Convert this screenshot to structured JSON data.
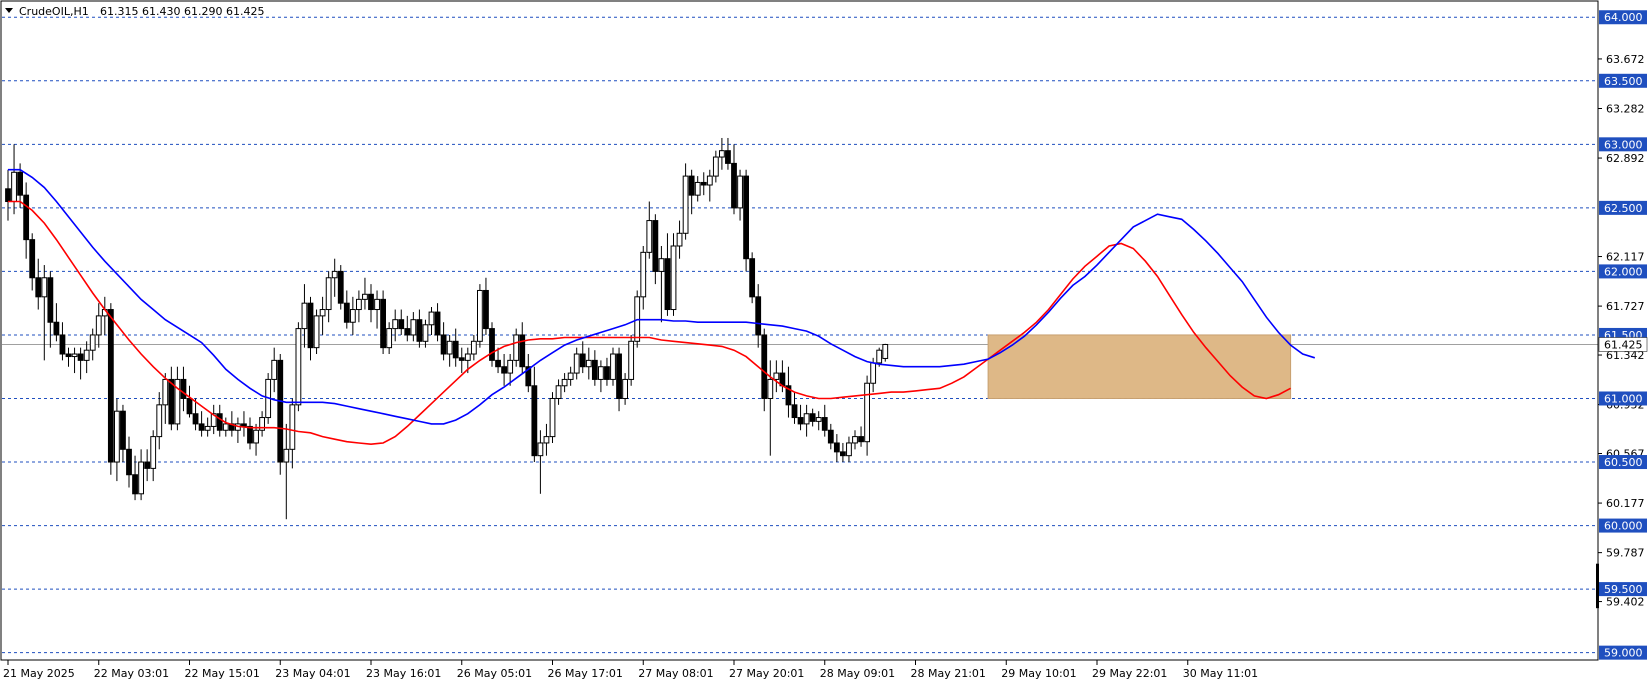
{
  "header": {
    "symbol": "CrudeOIL,H1",
    "ohlc": "61.315 61.430 61.290 61.425",
    "menu_icon": "triangle-down-icon"
  },
  "colors": {
    "bull_body": "#ffffff",
    "bear_body": "#000000",
    "ema_fast": "#0000ff",
    "ema_slow": "#ff0000",
    "grid_line": "#1f4fbf",
    "badge_fill": "#1f4fbf",
    "zone_fill": "#deb887",
    "zone_stroke": "#c8a070"
  },
  "chart_data": {
    "type": "candlestick",
    "symbol": "CrudeOIL",
    "timeframe": "H1",
    "last_price": 61.425,
    "ylim": [
      58.95,
      64.12
    ],
    "price_axis_ticks": [
      "64.000",
      "63.672",
      "63.500",
      "63.282",
      "63.000",
      "62.892",
      "62.500",
      "62.117",
      "62.000",
      "61.727",
      "61.500",
      "61.425",
      "61.342",
      "61.000",
      "60.952",
      "60.567",
      "60.500",
      "60.177",
      "60.000",
      "59.787",
      "59.500",
      "59.402",
      "59.000"
    ],
    "level_lines": [
      64.0,
      63.5,
      63.0,
      62.5,
      62.0,
      61.5,
      61.0,
      60.5,
      60.0,
      59.5,
      59.0
    ],
    "level_labels": [
      "64.000",
      "63.500",
      "63.000",
      "62.500",
      "62.000",
      "61.500",
      "61.000",
      "60.500",
      "60.000",
      "59.500",
      "59.000"
    ],
    "unmarked_ticks": [
      63.672,
      63.282,
      62.892,
      62.117,
      61.727,
      61.342,
      60.952,
      60.567,
      60.177,
      59.787,
      59.402
    ],
    "unmarked_labels": [
      "63.672",
      "63.282",
      "62.892",
      "62.117",
      "61.727",
      "61.342",
      "60.952",
      "60.567",
      "60.177",
      "59.787",
      "59.402"
    ],
    "time_labels": [
      "21 May 2025",
      "22 May 03:01",
      "22 May 15:01",
      "23 May 04:01",
      "23 May 16:01",
      "26 May 05:01",
      "26 May 17:01",
      "27 May 08:01",
      "27 May 20:01",
      "28 May 09:01",
      "28 May 21:01",
      "29 May 10:01",
      "29 May 22:01",
      "30 May 11:01"
    ],
    "time_label_bar_index": [
      0,
      15,
      30,
      45,
      60,
      75,
      90,
      105,
      120,
      135,
      150,
      165,
      180,
      195
    ],
    "candles": [
      [
        62.65,
        62.8,
        62.4,
        62.55
      ],
      [
        62.55,
        63.0,
        62.45,
        62.78
      ],
      [
        62.78,
        62.85,
        62.5,
        62.6
      ],
      [
        62.6,
        62.7,
        62.1,
        62.25
      ],
      [
        62.25,
        62.3,
        61.85,
        61.95
      ],
      [
        61.95,
        62.1,
        61.7,
        61.8
      ],
      [
        61.8,
        62.05,
        61.3,
        61.95
      ],
      [
        61.95,
        62.0,
        61.4,
        61.6
      ],
      [
        61.6,
        61.75,
        61.45,
        61.5
      ],
      [
        61.5,
        61.6,
        61.3,
        61.35
      ],
      [
        61.35,
        61.4,
        61.25,
        61.33
      ],
      [
        61.33,
        61.4,
        61.2,
        61.35
      ],
      [
        61.35,
        61.4,
        61.15,
        61.3
      ],
      [
        61.3,
        61.45,
        61.2,
        61.38
      ],
      [
        61.38,
        61.55,
        61.3,
        61.5
      ],
      [
        61.5,
        61.75,
        61.4,
        61.65
      ],
      [
        61.65,
        61.8,
        61.5,
        61.7
      ],
      [
        61.7,
        61.75,
        60.4,
        60.5
      ],
      [
        60.5,
        61.0,
        60.35,
        60.9
      ],
      [
        60.9,
        60.95,
        60.5,
        60.6
      ],
      [
        60.6,
        60.7,
        60.3,
        60.4
      ],
      [
        60.4,
        60.55,
        60.2,
        60.25
      ],
      [
        60.25,
        60.6,
        60.2,
        60.5
      ],
      [
        60.5,
        60.6,
        60.35,
        60.45
      ],
      [
        60.45,
        60.75,
        60.35,
        60.7
      ],
      [
        60.7,
        61.05,
        60.6,
        60.95
      ],
      [
        60.95,
        61.2,
        60.8,
        61.15
      ],
      [
        61.15,
        61.25,
        60.75,
        60.8
      ],
      [
        60.8,
        61.25,
        60.75,
        61.15
      ],
      [
        61.15,
        61.25,
        60.9,
        61.0
      ],
      [
        61.0,
        61.1,
        60.85,
        60.88
      ],
      [
        60.88,
        61.0,
        60.75,
        60.8
      ],
      [
        60.8,
        60.9,
        60.7,
        60.75
      ],
      [
        60.75,
        60.85,
        60.7,
        60.78
      ],
      [
        60.78,
        60.95,
        60.72,
        60.88
      ],
      [
        60.88,
        60.95,
        60.7,
        60.75
      ],
      [
        60.75,
        60.85,
        60.7,
        60.8
      ],
      [
        60.8,
        60.9,
        60.7,
        60.75
      ],
      [
        60.75,
        60.85,
        60.65,
        60.8
      ],
      [
        60.8,
        60.9,
        60.7,
        60.78
      ],
      [
        60.78,
        60.85,
        60.6,
        60.65
      ],
      [
        60.65,
        60.8,
        60.55,
        60.75
      ],
      [
        60.75,
        60.9,
        60.7,
        60.85
      ],
      [
        60.85,
        61.2,
        60.8,
        61.15
      ],
      [
        61.15,
        61.4,
        61.05,
        61.3
      ],
      [
        61.3,
        61.35,
        60.4,
        60.5
      ],
      [
        60.5,
        60.8,
        60.05,
        60.6
      ],
      [
        60.6,
        61.0,
        60.45,
        60.95
      ],
      [
        60.95,
        61.6,
        60.9,
        61.55
      ],
      [
        61.55,
        61.9,
        61.4,
        61.75
      ],
      [
        61.75,
        61.8,
        61.3,
        61.4
      ],
      [
        61.4,
        61.7,
        61.35,
        61.65
      ],
      [
        61.65,
        61.8,
        61.5,
        61.7
      ],
      [
        61.7,
        62.0,
        61.6,
        61.95
      ],
      [
        61.95,
        62.1,
        61.8,
        62.0
      ],
      [
        62.0,
        62.05,
        61.7,
        61.75
      ],
      [
        61.75,
        61.85,
        61.55,
        61.6
      ],
      [
        61.6,
        61.8,
        61.5,
        61.7
      ],
      [
        61.7,
        61.85,
        61.6,
        61.78
      ],
      [
        61.78,
        61.95,
        61.7,
        61.82
      ],
      [
        61.82,
        61.9,
        61.6,
        61.7
      ],
      [
        61.7,
        61.85,
        61.55,
        61.78
      ],
      [
        61.78,
        61.85,
        61.35,
        61.4
      ],
      [
        61.4,
        61.6,
        61.35,
        61.55
      ],
      [
        61.55,
        61.7,
        61.45,
        61.62
      ],
      [
        61.62,
        61.7,
        61.5,
        61.55
      ],
      [
        61.55,
        61.65,
        61.45,
        61.5
      ],
      [
        61.5,
        61.68,
        61.45,
        61.62
      ],
      [
        61.62,
        61.7,
        61.4,
        61.45
      ],
      [
        61.45,
        61.62,
        61.4,
        61.58
      ],
      [
        61.58,
        61.72,
        61.5,
        61.68
      ],
      [
        61.68,
        61.75,
        61.45,
        61.5
      ],
      [
        61.5,
        61.6,
        61.3,
        61.35
      ],
      [
        61.35,
        61.5,
        61.25,
        61.45
      ],
      [
        61.45,
        61.55,
        61.25,
        61.32
      ],
      [
        61.32,
        61.4,
        61.2,
        61.3
      ],
      [
        61.3,
        61.4,
        61.2,
        61.35
      ],
      [
        61.35,
        61.5,
        61.3,
        61.45
      ],
      [
        61.45,
        61.9,
        61.4,
        61.85
      ],
      [
        61.85,
        61.95,
        61.5,
        61.55
      ],
      [
        61.55,
        61.6,
        61.25,
        61.3
      ],
      [
        61.3,
        61.4,
        61.2,
        61.25
      ],
      [
        61.25,
        61.35,
        61.1,
        61.2
      ],
      [
        61.2,
        61.35,
        61.1,
        61.3
      ],
      [
        61.3,
        61.55,
        61.25,
        61.5
      ],
      [
        61.5,
        61.6,
        61.2,
        61.25
      ],
      [
        61.25,
        61.35,
        61.05,
        61.1
      ],
      [
        61.1,
        61.25,
        60.5,
        60.55
      ],
      [
        60.55,
        60.75,
        60.25,
        60.65
      ],
      [
        60.65,
        60.8,
        60.55,
        60.7
      ],
      [
        60.7,
        61.05,
        60.65,
        61.0
      ],
      [
        61.0,
        61.15,
        60.95,
        61.1
      ],
      [
        61.1,
        61.2,
        61.05,
        61.15
      ],
      [
        61.15,
        61.25,
        61.1,
        61.2
      ],
      [
        61.2,
        61.4,
        61.15,
        61.35
      ],
      [
        61.35,
        61.45,
        61.2,
        61.25
      ],
      [
        61.25,
        61.4,
        61.15,
        61.3
      ],
      [
        61.3,
        61.38,
        61.1,
        61.15
      ],
      [
        61.15,
        61.3,
        61.05,
        61.25
      ],
      [
        61.25,
        61.32,
        61.1,
        61.15
      ],
      [
        61.15,
        61.4,
        61.1,
        61.35
      ],
      [
        61.35,
        61.4,
        60.9,
        61.0
      ],
      [
        61.0,
        61.2,
        60.95,
        61.15
      ],
      [
        61.15,
        61.5,
        61.1,
        61.45
      ],
      [
        61.45,
        61.85,
        61.4,
        61.8
      ],
      [
        61.8,
        62.2,
        61.7,
        62.15
      ],
      [
        62.15,
        62.55,
        62.1,
        62.4
      ],
      [
        62.4,
        62.45,
        61.9,
        62.0
      ],
      [
        62.0,
        62.2,
        61.6,
        62.1
      ],
      [
        62.1,
        62.3,
        61.65,
        61.7
      ],
      [
        61.7,
        62.3,
        61.65,
        62.2
      ],
      [
        62.2,
        62.4,
        62.1,
        62.3
      ],
      [
        62.3,
        62.85,
        62.25,
        62.75
      ],
      [
        62.75,
        62.8,
        62.45,
        62.6
      ],
      [
        62.6,
        62.75,
        62.55,
        62.7
      ],
      [
        62.7,
        62.78,
        62.6,
        62.68
      ],
      [
        62.68,
        62.8,
        62.55,
        62.75
      ],
      [
        62.75,
        62.95,
        62.7,
        62.9
      ],
      [
        62.9,
        63.05,
        62.8,
        62.95
      ],
      [
        62.95,
        63.05,
        62.8,
        62.85
      ],
      [
        62.85,
        63.0,
        62.45,
        62.5
      ],
      [
        62.5,
        62.8,
        62.4,
        62.75
      ],
      [
        62.75,
        62.8,
        62.0,
        62.1
      ],
      [
        62.1,
        62.15,
        61.75,
        61.8
      ],
      [
        61.8,
        61.9,
        61.4,
        61.5
      ],
      [
        61.5,
        61.55,
        60.9,
        61.0
      ],
      [
        61.0,
        61.3,
        60.55,
        61.15
      ],
      [
        61.15,
        61.3,
        61.05,
        61.2
      ],
      [
        61.2,
        61.3,
        61.05,
        61.1
      ],
      [
        61.1,
        61.25,
        60.85,
        60.95
      ],
      [
        60.95,
        61.05,
        60.8,
        60.85
      ],
      [
        60.85,
        60.95,
        60.75,
        60.8
      ],
      [
        60.8,
        60.95,
        60.7,
        60.88
      ],
      [
        60.88,
        60.92,
        60.78,
        60.82
      ],
      [
        60.82,
        60.9,
        60.75,
        60.85
      ],
      [
        60.85,
        60.95,
        60.7,
        60.75
      ],
      [
        60.75,
        60.8,
        60.6,
        60.65
      ],
      [
        60.65,
        60.72,
        60.5,
        60.58
      ],
      [
        60.58,
        60.65,
        60.5,
        60.55
      ],
      [
        60.55,
        60.7,
        60.5,
        60.65
      ],
      [
        60.65,
        60.75,
        60.6,
        60.7
      ],
      [
        60.7,
        60.78,
        60.62,
        60.66
      ],
      [
        60.66,
        61.18,
        60.55,
        61.12
      ],
      [
        61.12,
        61.32,
        61.05,
        61.28
      ],
      [
        61.28,
        61.4,
        61.25,
        61.38
      ],
      [
        61.315,
        61.43,
        61.29,
        61.425
      ]
    ],
    "ema_fast": [
      62.8,
      62.8,
      62.74,
      62.66,
      62.55,
      62.43,
      62.31,
      62.19,
      62.08,
      61.98,
      61.88,
      61.78,
      61.7,
      61.62,
      61.56,
      61.5,
      61.44,
      61.34,
      61.23,
      61.15,
      61.08,
      61.02,
      60.99,
      60.97,
      60.97,
      60.97,
      60.97,
      60.96,
      60.94,
      60.92,
      60.9,
      60.88,
      60.86,
      60.84,
      60.82,
      60.8,
      60.8,
      60.83,
      60.88,
      60.95,
      61.03,
      61.09,
      61.16,
      61.23,
      61.3,
      61.36,
      61.42,
      61.46,
      61.49,
      61.52,
      61.55,
      61.58,
      61.62,
      61.62,
      61.62,
      61.61,
      61.61,
      61.6,
      61.6,
      61.6,
      61.6,
      61.6,
      61.59,
      61.58,
      61.57,
      61.55,
      61.53,
      61.49,
      61.43,
      61.38,
      61.33,
      61.29,
      61.27,
      61.26,
      61.25,
      61.25,
      61.25,
      61.25,
      61.26,
      61.27,
      61.29,
      61.31,
      61.36,
      61.42,
      61.49,
      61.58,
      61.68,
      61.79,
      61.89,
      61.96,
      62.05,
      62.15,
      62.25,
      62.35,
      62.4,
      62.45,
      62.43,
      62.41,
      62.33,
      62.24,
      62.14,
      62.03,
      61.92,
      61.78,
      61.64,
      61.52,
      61.42,
      61.35,
      61.32
    ],
    "ema_fast_start": 0,
    "ema_slow": [
      62.55,
      62.55,
      62.48,
      62.38,
      62.25,
      62.11,
      61.97,
      61.83,
      61.7,
      61.58,
      61.46,
      61.35,
      61.25,
      61.16,
      61.08,
      61.01,
      60.94,
      60.87,
      60.81,
      60.78,
      60.77,
      60.77,
      60.77,
      60.76,
      60.74,
      60.73,
      60.7,
      60.68,
      60.66,
      60.65,
      60.64,
      60.65,
      60.7,
      60.78,
      60.87,
      60.96,
      61.05,
      61.14,
      61.23,
      61.3,
      61.36,
      61.41,
      61.44,
      61.46,
      61.47,
      61.47,
      61.48,
      61.48,
      61.48,
      61.48,
      61.48,
      61.48,
      61.48,
      61.48,
      61.46,
      61.45,
      61.44,
      61.43,
      61.42,
      61.41,
      61.38,
      61.33,
      61.25,
      61.17,
      61.1,
      61.05,
      61.02,
      61.0,
      61.0,
      61.01,
      61.02,
      61.03,
      61.04,
      61.05,
      61.05,
      61.06,
      61.07,
      61.08,
      61.12,
      61.17,
      61.24,
      61.31,
      61.38,
      61.45,
      61.52,
      61.6,
      61.7,
      61.82,
      61.94,
      62.04,
      62.12,
      62.2,
      62.22,
      62.18,
      62.08,
      61.96,
      61.81,
      61.66,
      61.52,
      61.4,
      61.29,
      61.18,
      61.09,
      61.02,
      61.0,
      61.03,
      61.08
    ],
    "zone": {
      "top": 61.5,
      "bottom": 61.0,
      "from_bar": 162,
      "to_bar": 212
    },
    "current_price_line": 61.425
  }
}
